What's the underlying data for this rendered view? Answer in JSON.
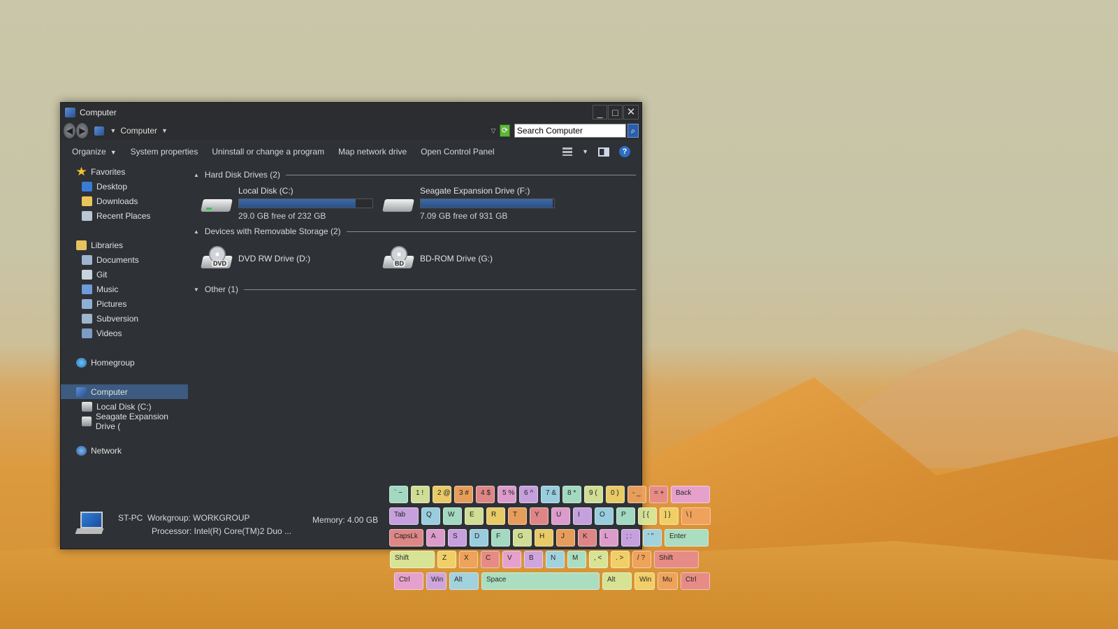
{
  "window": {
    "title": "Computer",
    "controls": {
      "minimize": "_",
      "maximize": "□",
      "close": "✕"
    }
  },
  "addressbar": {
    "location": "Computer",
    "search_value": "Search Computer"
  },
  "commandbar": {
    "organize": "Organize",
    "system_properties": "System properties",
    "uninstall": "Uninstall or change a program",
    "map_drive": "Map network drive",
    "control_panel": "Open Control Panel"
  },
  "sidebar": {
    "favorites": "Favorites",
    "favorites_items": [
      "Desktop",
      "Downloads",
      "Recent Places"
    ],
    "libraries": "Libraries",
    "libraries_items": [
      "Documents",
      "Git",
      "Music",
      "Pictures",
      "Subversion",
      "Videos"
    ],
    "homegroup": "Homegroup",
    "computer": "Computer",
    "computer_items": [
      "Local Disk (C:)",
      "Seagate Expansion Drive ("
    ],
    "network": "Network"
  },
  "groups": {
    "hdd_header": "Hard Disk Drives (2)",
    "removable_header": "Devices with Removable Storage (2)",
    "other_header": "Other (1)"
  },
  "drives": [
    {
      "name": "Local Disk (C:)",
      "free_text": "29.0 GB free of 232 GB",
      "used_fraction": 0.875
    },
    {
      "name": "Seagate Expansion Drive (F:)",
      "free_text": "7.09 GB free of 931 GB",
      "used_fraction": 0.992
    }
  ],
  "removable": [
    {
      "name": "DVD RW Drive (D:)",
      "badge": "DVD"
    },
    {
      "name": "BD-ROM Drive (G:)",
      "badge": "BD"
    }
  ],
  "details": {
    "pc_name": "ST-PC",
    "workgroup": "Workgroup: WORKGROUP",
    "memory": "Memory: 4.00 GB",
    "processor": "Processor: Intel(R) Core(TM)2 Duo ..."
  },
  "keyboard": {
    "rows": [
      [
        "` ~",
        "1 !",
        "2 @",
        "3 #",
        "4 $",
        "5 %",
        "6 ^",
        "7 &",
        "8 *",
        "9 (",
        "0 )",
        "- _",
        "= +",
        "Back"
      ],
      [
        "Tab",
        "Q",
        "W",
        "E",
        "R",
        "T",
        "Y",
        "U",
        "I",
        "O",
        "P",
        "[ {",
        "] }",
        "\\ |"
      ],
      [
        "CapsLk",
        "A",
        "S",
        "D",
        "F",
        "G",
        "H",
        "J",
        "K",
        "L",
        "; :",
        "' \"",
        "Enter"
      ],
      [
        "Shift",
        "Z",
        "X",
        "C",
        "V",
        "B",
        "N",
        "M",
        ", <",
        ". >",
        "/ ?",
        "Shift"
      ],
      [
        "Ctrl",
        "Win",
        "Alt",
        "Space",
        "Alt",
        "Win",
        "Mu",
        "Ctrl"
      ]
    ],
    "palette": [
      "#a9e2c8",
      "#d8e89a",
      "#f2d36a",
      "#f0a35e",
      "#e88b8b",
      "#e6a2d4",
      "#cfa6e6",
      "#9fd6e6"
    ]
  }
}
